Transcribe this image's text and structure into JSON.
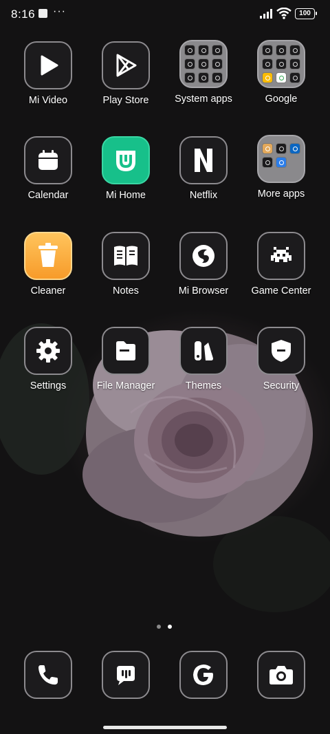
{
  "status_bar": {
    "time": "8:16",
    "more_indicator": "···",
    "battery": "100"
  },
  "apps": [
    {
      "label": "Mi Video",
      "icon": "play-icon"
    },
    {
      "label": "Play Store",
      "icon": "play-store-icon"
    },
    {
      "label": "System apps",
      "icon": "folder-icon"
    },
    {
      "label": "Google",
      "icon": "folder-icon"
    },
    {
      "label": "Calendar",
      "icon": "calendar-icon"
    },
    {
      "label": "Mi Home",
      "icon": "mi-home-icon"
    },
    {
      "label": "Netflix",
      "icon": "netflix-icon"
    },
    {
      "label": "More apps",
      "icon": "folder-icon"
    },
    {
      "label": "Cleaner",
      "icon": "trash-icon"
    },
    {
      "label": "Notes",
      "icon": "book-icon"
    },
    {
      "label": "Mi Browser",
      "icon": "browser-icon"
    },
    {
      "label": "Game Center",
      "icon": "space-invader-icon"
    },
    {
      "label": "Settings",
      "icon": "gear-icon"
    },
    {
      "label": "File Manager",
      "icon": "file-icon"
    },
    {
      "label": "Themes",
      "icon": "themes-icon"
    },
    {
      "label": "Security",
      "icon": "shield-icon"
    }
  ],
  "dock": [
    {
      "icon": "phone-icon"
    },
    {
      "icon": "messages-icon"
    },
    {
      "icon": "google-icon"
    },
    {
      "icon": "camera-icon"
    }
  ],
  "page_indicator": {
    "pages": 2,
    "current": 2
  }
}
